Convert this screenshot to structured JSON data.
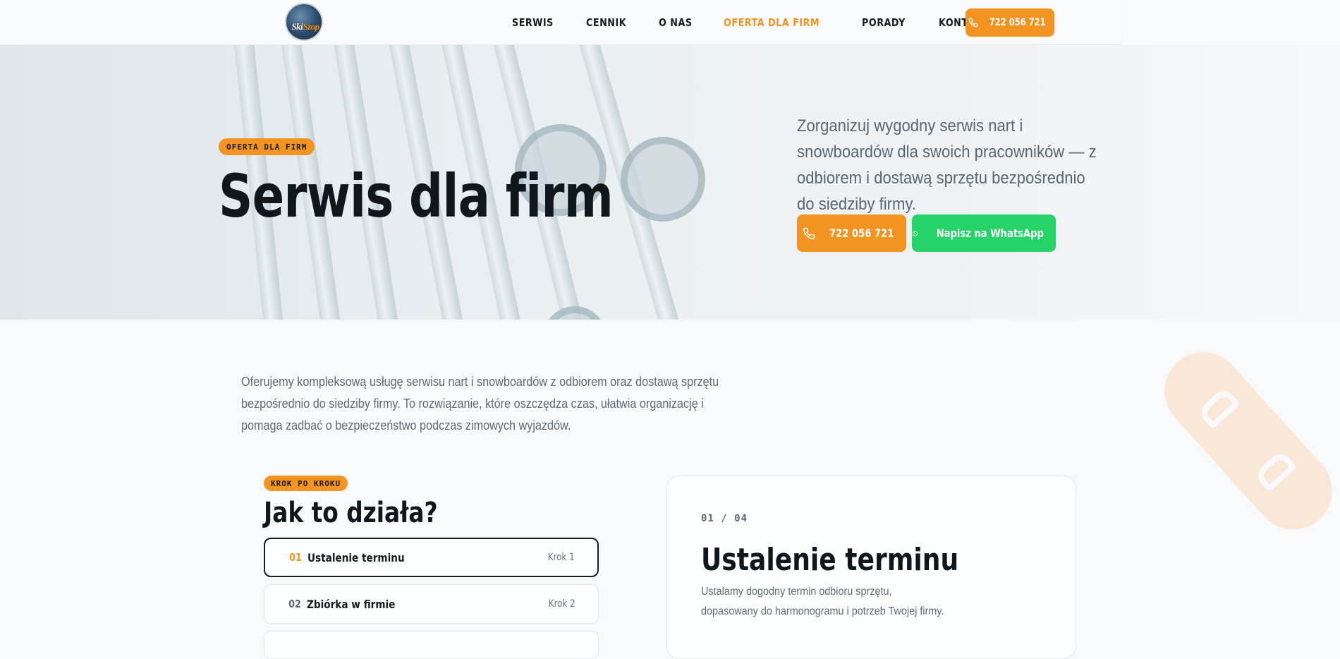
{
  "nav": {
    "logo_text_a": "Ski",
    "logo_text_b": "Szop",
    "items": [
      {
        "label": "SERWIS",
        "active": false
      },
      {
        "label": "CENNIK",
        "active": false
      },
      {
        "label": "O NAS",
        "active": false
      },
      {
        "label": "OFERTA DLA FIRM",
        "active": true
      },
      {
        "label": "PORADY",
        "active": false
      },
      {
        "label": "KONTAKT",
        "active": false
      }
    ],
    "phone_label": "722 056 721"
  },
  "hero": {
    "tag": "OFERTA DLA FIRM",
    "title": "Serwis dla firm",
    "subtitle": "Zorganizuj wygodny serwis nart i snowboardów dla swoich pracowników — z odbiorem i dostawą sprzętu bezpośrednio do siedziby firmy.",
    "phone_button": "722 056 721",
    "whatsapp_button": "Napisz na WhatsApp"
  },
  "intro": {
    "text": "Oferujemy kompleksową usługę serwisu nart i snowboardów z odbiorem oraz dostawą sprzętu bezpośrednio do siedziby firmy. To rozwiązanie, które oszczędza czas, ułatwia organizację i pomaga zadbać o bezpieczeństwo podczas zimowych wyjazdów."
  },
  "steps": {
    "tag": "KROK PO KROKU",
    "title": "Jak to działa?",
    "items": [
      {
        "num": "01",
        "name": "Ustalenie terminu",
        "krok": "Krok 1"
      },
      {
        "num": "02",
        "name": "Zbiórka w firmie",
        "krok": "Krok 2"
      }
    ],
    "selected": {
      "counter": "01 / 04",
      "title": "Ustalenie terminu",
      "description": "Ustalamy dogodny termin odbioru sprzętu, dopasowany do harmonogramu i potrzeb Twojej firmy."
    }
  },
  "colors": {
    "accent": "#f39322",
    "whatsapp": "#25d366",
    "dark": "#0f171d",
    "muted": "#5c6a75"
  }
}
